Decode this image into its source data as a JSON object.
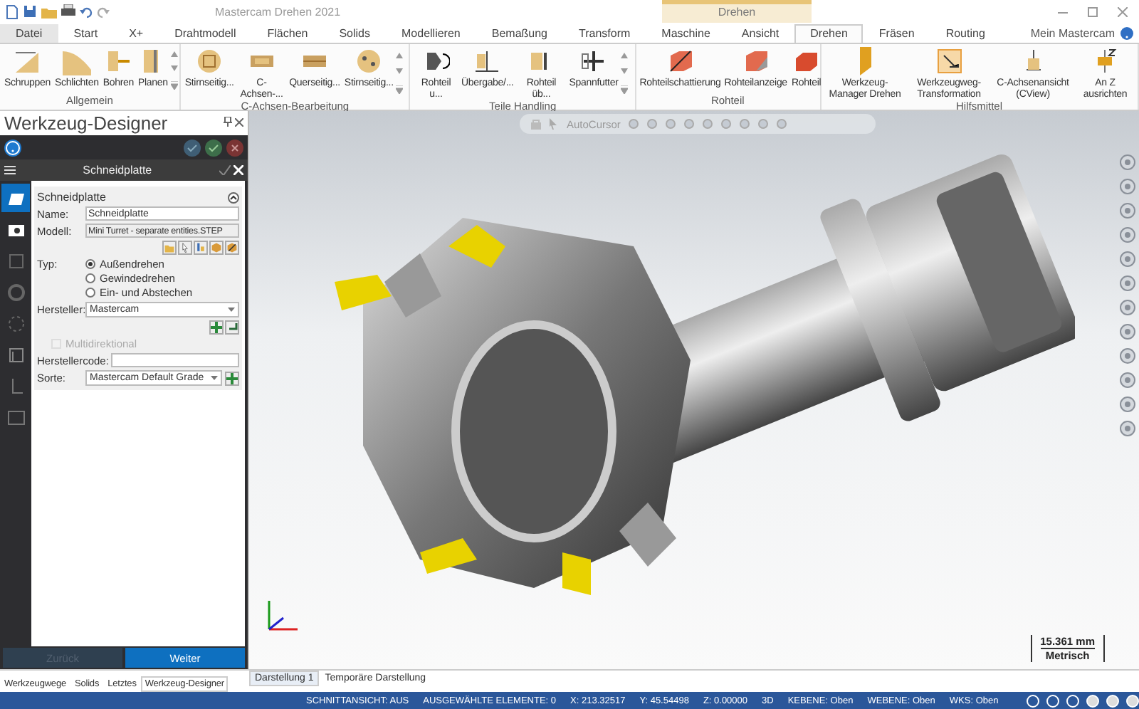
{
  "window": {
    "title": "Mastercam Drehen 2021",
    "context_tab": "Drehen"
  },
  "tabs": [
    {
      "label": "Datei",
      "selected": false,
      "kind": "file"
    },
    {
      "label": "Start",
      "selected": false
    },
    {
      "label": "X+",
      "selected": false
    },
    {
      "label": "Drahtmodell",
      "selected": false
    },
    {
      "label": "Flächen",
      "selected": false
    },
    {
      "label": "Solids",
      "selected": false
    },
    {
      "label": "Modellieren",
      "selected": false
    },
    {
      "label": "Bemaßung",
      "selected": false
    },
    {
      "label": "Transform",
      "selected": false
    },
    {
      "label": "Maschine",
      "selected": false
    },
    {
      "label": "Ansicht",
      "selected": false
    },
    {
      "label": "Drehen",
      "selected": true
    },
    {
      "label": "Fräsen",
      "selected": false
    },
    {
      "label": "Routing",
      "selected": false
    }
  ],
  "account": "Mein Mastercam",
  "ribbon": [
    {
      "label": "Allgemein",
      "scroll": true,
      "items": [
        "Schruppen",
        "Schlichten",
        "Bohren",
        "Planen"
      ]
    },
    {
      "label": "C-Achsen-Bearbeitung",
      "scroll": true,
      "items": [
        "Stirnseitig...",
        "C-Achsen-...",
        "Querseitig...",
        "Stirnseitig..."
      ]
    },
    {
      "label": "Teile Handling",
      "scroll": true,
      "items": [
        "Rohteil u...",
        "Übergabe/...",
        "Rohteil üb...",
        "Spannfutter"
      ]
    },
    {
      "label": "Rohteil",
      "scroll": false,
      "items": [
        "Rohteilschattierung",
        "Rohteilanzeige",
        "Rohteil"
      ]
    },
    {
      "label": "Hilfsmittel",
      "scroll": false,
      "items": [
        "Werkzeug-Manager Drehen",
        "Werkzeugweg-Transformation",
        "C-Achsenansicht (CView)",
        "An Z ausrichten"
      ]
    }
  ],
  "panel": {
    "title": "Werkzeug-Designer",
    "step": "Schneidplatte",
    "side_items": [
      {
        "selected": true
      },
      {
        "selected": false
      },
      {
        "selected": false
      },
      {
        "selected": false
      },
      {
        "selected": false
      },
      {
        "selected": false
      },
      {
        "selected": false
      },
      {
        "selected": false
      }
    ],
    "section": "Schneidplatte",
    "name": {
      "label": "Name:",
      "value": "Schneidplatte"
    },
    "model": {
      "label": "Modell:",
      "value": "Mini Turret - separate entities.STEP"
    },
    "type": {
      "label": "Typ:",
      "options": [
        {
          "label": "Außendrehen",
          "selected": true
        },
        {
          "label": "Gewindedrehen",
          "selected": false
        },
        {
          "label": "Ein- und Abstechen",
          "selected": false
        }
      ]
    },
    "manufacturer": {
      "label": "Hersteller:",
      "value": "Mastercam"
    },
    "multidirectional": {
      "label": "Multidirektional",
      "checked": false,
      "disabled": true
    },
    "manufacturer_code": {
      "label": "Herstellercode:"
    },
    "grade": {
      "label": "Sorte:",
      "value": "Mastercam Default Grade"
    },
    "buttons": [
      {
        "label": "Zurück",
        "disabled": true
      },
      {
        "label": "Weiter",
        "disabled": false
      }
    ]
  },
  "viewport": {
    "toolbar": "AutoCursor",
    "scale": "15.361 mm",
    "unit": "Metrisch",
    "tabs": [
      {
        "label": "Darstellung 1",
        "selected": true
      },
      {
        "label": "Temporäre Darstellung",
        "selected": false
      }
    ]
  },
  "manager_tabs": [
    {
      "label": "Werkzeugwege",
      "selected": false
    },
    {
      "label": "Solids",
      "selected": false
    },
    {
      "label": "Letztes",
      "selected": false
    },
    {
      "label": "Werkzeug-Designer",
      "selected": true
    }
  ],
  "status_bar": [
    "SCHNITTANSICHT: AUS",
    "AUSGEWÄHLTE ELEMENTE: 0",
    "X:  213.32517",
    "Y:  45.54498",
    "Z:  0.00000",
    "3D",
    "KEBENE: Oben",
    "WEBENE: Oben",
    "WKS: Oben"
  ]
}
